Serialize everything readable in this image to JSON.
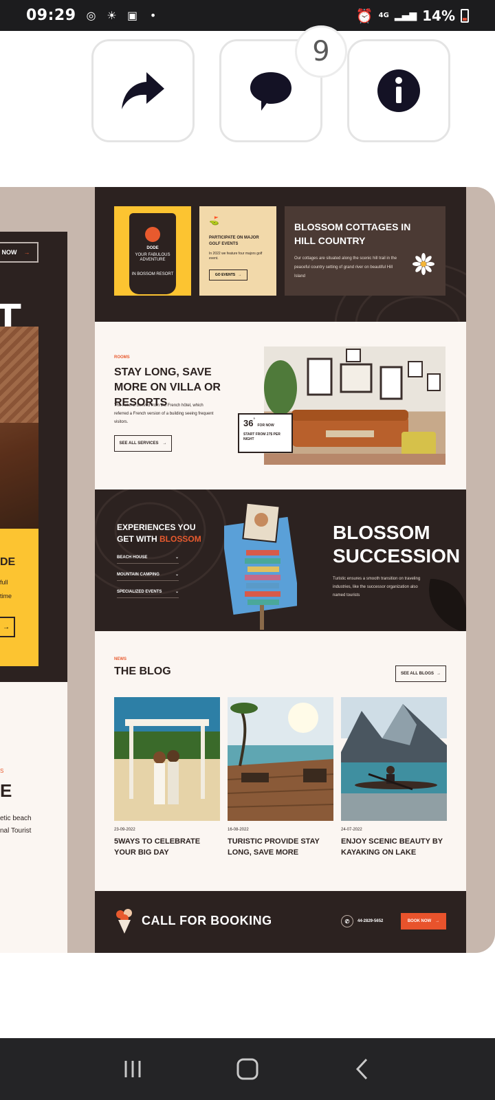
{
  "status_bar": {
    "time": "09:29",
    "network": "4G",
    "battery": "14%"
  },
  "actions": {
    "comment_count": "9"
  },
  "left_page": {
    "button_label": "NOW",
    "big_letter": "T",
    "yellow_title": "DE",
    "yellow_text_1": "full",
    "yellow_text_2": "time",
    "news_tag": "S",
    "big_letter_2": "E",
    "text_line_1": "etic beach",
    "text_line_2": "nal Tourist"
  },
  "hero_cards": {
    "phone_title": "DODE",
    "phone_sub": "YOUR FABULOUS ADVENTURE",
    "phone_footer": "IN BOSSOM RESORT",
    "beige_title": "PARTICIPATE ON MAJOR GOLF EVENTS",
    "beige_text": "In 2022 we feature four majors golf event.",
    "beige_button": "GO EVENTS",
    "dark_title": "BLOSSOM COTTAGES IN HILL COUNTRY",
    "dark_text": "Our cottages are situated along the scenic hill trail in the peaceful country setting of grand river on beautiful Hill Island"
  },
  "stay_section": {
    "tag": "ROOMS",
    "title": "STAY LONG, SAVE MORE ON VILLA OR RESORTS",
    "desc": "The hotel is derived from the French hôtel, which referred a French version of a building seeing frequent visitors.",
    "button": "SEE ALL SERVICES",
    "info_number": "36",
    "info_unit": "°",
    "info_sub": "FOR NOW",
    "info_text": "START FROM 27$ PER NIGHT"
  },
  "experience_section": {
    "title_prefix": "EXPERIENCES YOU GET WITH",
    "title_brand": "BLOSSOM",
    "items": [
      "BEACH HOUSE",
      "MOUNTAIN CAMPING",
      "SPECIALIZED EVENTS"
    ],
    "big_title": "BLOSSOM SUCCESSION",
    "desc": "Turistic ensures a smooth transition on traveling industries, like the successor organization also named tourists"
  },
  "blog_section": {
    "tag": "NEWS",
    "title": "THE BLOG",
    "button": "SEE ALL BLOGS",
    "posts": [
      {
        "date": "23-09-2022",
        "title": "5WAYS TO CELEBRATE YOUR BIG DAY"
      },
      {
        "date": "16-08-2022",
        "title": "TURISTIC PROVIDE STAY LONG, SAVE MORE"
      },
      {
        "date": "24-07-2022",
        "title": "ENJOY SCENIC BEAUTY BY KAYAKING ON LAKE"
      }
    ]
  },
  "booking_section": {
    "title": "CALL FOR BOOKING",
    "phone": "44-2829-5652",
    "button": "BOOK NOW"
  },
  "colors": {
    "dark_brown": "#2c2220",
    "accent_orange": "#e85a2e",
    "yellow": "#fcc431",
    "cream": "#fbf6f2"
  }
}
